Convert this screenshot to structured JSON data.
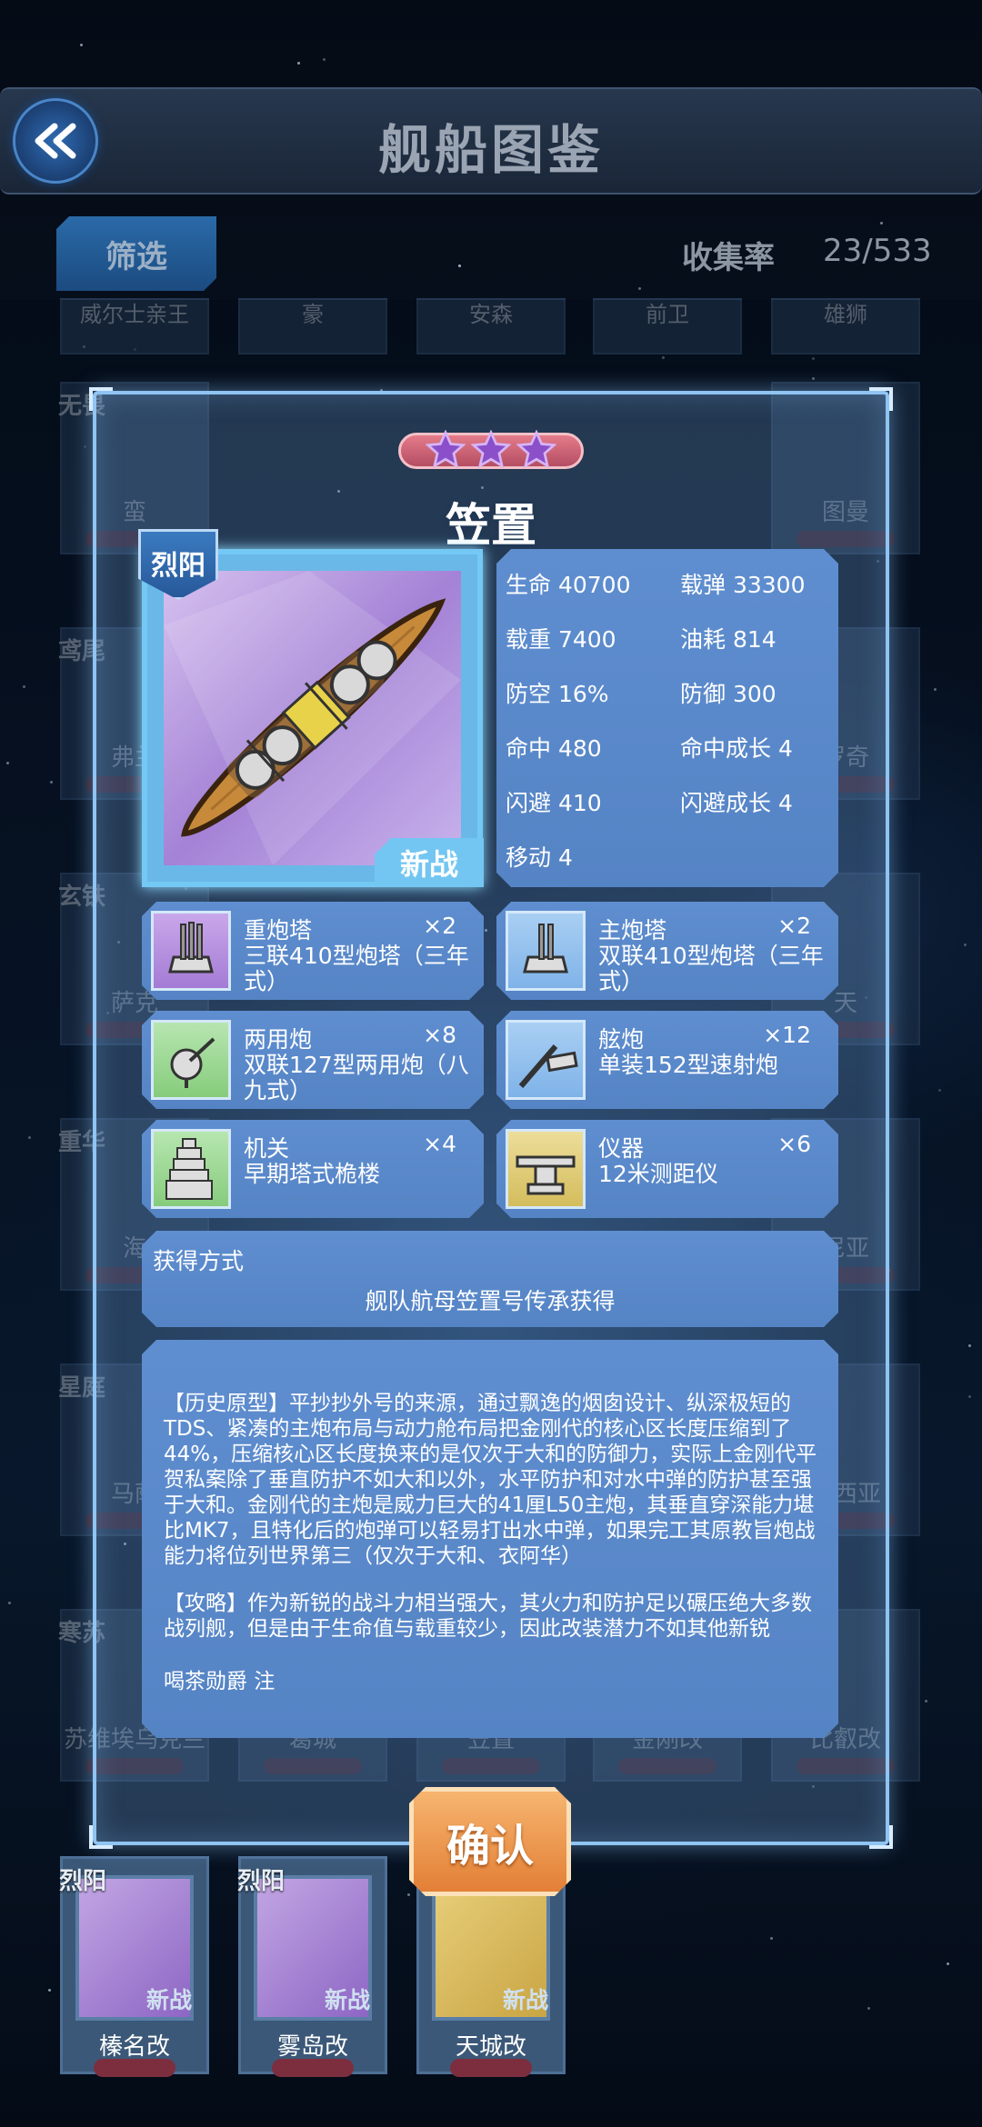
{
  "header": {
    "title": "舰船图鉴"
  },
  "filter_label": "筛选",
  "collection": {
    "label": "收集率",
    "value": "23/533"
  },
  "background_rows": {
    "top_row": [
      "威尔士亲王",
      "豪",
      "安森",
      "前卫",
      "雄狮"
    ],
    "left_factions": [
      "无畏",
      "鸢尾",
      "玄铁",
      "重华",
      "星庭",
      "寒苏"
    ],
    "left_names": [
      "蛮",
      "弗兰",
      "萨克",
      "海",
      "马萨",
      "苏维埃乌克兰"
    ],
    "mid_row_names": [
      "葛城",
      "笠置",
      "金刚改",
      "比叡改"
    ],
    "right_names": [
      "图曼",
      "罗奇",
      "天",
      "尼亚",
      "墨西亚",
      "比叡改"
    ]
  },
  "ship": {
    "stars": 3,
    "name": "笠置",
    "faction": "烈阳",
    "tag": "新战",
    "stats": [
      {
        "label": "生命",
        "value": "40700"
      },
      {
        "label": "载弹",
        "value": "33300"
      },
      {
        "label": "载重",
        "value": "7400"
      },
      {
        "label": "油耗",
        "value": "814"
      },
      {
        "label": "防空",
        "value": "16%"
      },
      {
        "label": "防御",
        "value": "300"
      },
      {
        "label": "命中",
        "value": "480"
      },
      {
        "label": "命中成长",
        "value": "4"
      },
      {
        "label": "闪避",
        "value": "410"
      },
      {
        "label": "闪避成长",
        "value": "4"
      },
      {
        "label": "移动",
        "value": "4"
      }
    ],
    "equipment": [
      {
        "type": "重炮塔",
        "count": "×2",
        "name": "三联410型炮塔（三年式）",
        "icon": "heavy-turret-icon"
      },
      {
        "type": "主炮塔",
        "count": "×2",
        "name": "双联410型炮塔（三年式）",
        "icon": "main-turret-icon"
      },
      {
        "type": "两用炮",
        "count": "×8",
        "name": "双联127型两用炮（八九式）",
        "icon": "dual-purpose-gun-icon"
      },
      {
        "type": "舷炮",
        "count": "×12",
        "name": "单装152型速射炮",
        "icon": "broadside-gun-icon"
      },
      {
        "type": "机关",
        "count": "×4",
        "name": "早期塔式桅楼",
        "icon": "pagoda-mast-icon"
      },
      {
        "type": "仪器",
        "count": "×6",
        "name": "12米测距仪",
        "icon": "rangefinder-icon"
      }
    ],
    "obtain": {
      "label": "获得方式",
      "value": "舰队航母笠置号传承获得"
    },
    "description": {
      "history": "【历史原型】平抄抄外号的来源，通过飘逸的烟囱设计、纵深极短的TDS、紧凑的主炮布局与动力舱布局把金刚代的核心区长度压缩到了44%，压缩核心区长度换来的是仅次于大和的防御力，实际上金刚代平贺私案除了垂直防护不如大和以外，水平防护和对水中弹的防护甚至强于大和。金刚代的主炮是威力巨大的41厘L50主炮，其垂直穿深能力堪比MK7，且特化后的炮弹可以轻易打出水中弹，如果完工其原教旨炮战能力将位列世界第三（仅次于大和、衣阿华）",
      "strategy": "【攻略】作为新锐的战斗力相当强大，其火力和防护足以碾压绝大多数战列舰，但是由于生命值与载重较少，因此改装潜力不如其他新锐",
      "author": "喝茶勋爵 注"
    }
  },
  "confirm_label": "确认",
  "bottom_cards": [
    {
      "faction": "烈阳",
      "tag": "新战",
      "name": "榛名改"
    },
    {
      "faction": "烈阳",
      "tag": "新战",
      "name": "雾岛改"
    },
    {
      "faction": "",
      "tag": "新战",
      "name": "天城改"
    }
  ],
  "colors": {
    "accent": "#73c6f1",
    "panel": "#5f8ed0",
    "confirm": "#e9893f",
    "star": "#8a4fc9"
  }
}
